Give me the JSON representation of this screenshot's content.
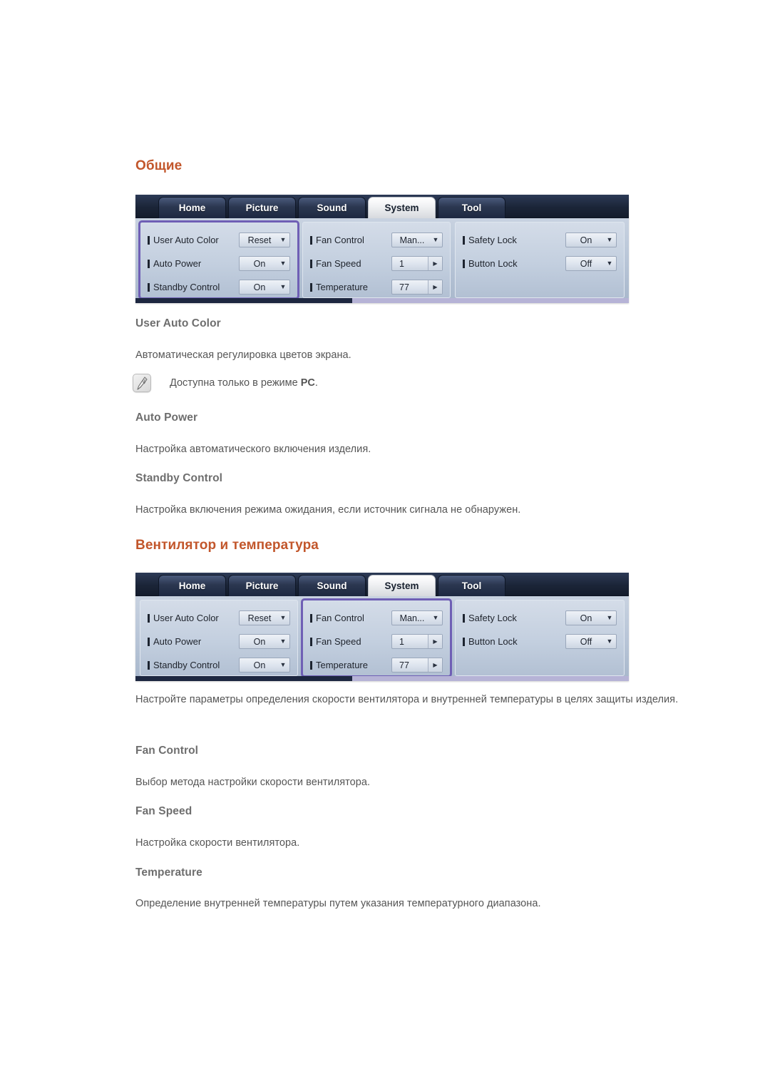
{
  "sections": [
    {
      "heading": "Общие",
      "osd": {
        "tabs": [
          {
            "label": "Home",
            "active": false
          },
          {
            "label": "Picture",
            "active": false
          },
          {
            "label": "Sound",
            "active": false
          },
          {
            "label": "System",
            "active": true
          },
          {
            "label": "Tool",
            "active": false
          }
        ],
        "highlight_column": 0,
        "columns": [
          {
            "rows": [
              {
                "label": "User Auto Color",
                "value": "Reset",
                "control": "dropdown"
              },
              {
                "label": "Auto Power",
                "value": "On",
                "control": "dropdown"
              },
              {
                "label": "Standby Control",
                "value": "On",
                "control": "dropdown"
              }
            ]
          },
          {
            "rows": [
              {
                "label": "Fan Control",
                "value": "Man...",
                "control": "dropdown"
              },
              {
                "label": "Fan Speed",
                "value": "1",
                "control": "spinner"
              },
              {
                "label": "Temperature",
                "value": "77",
                "control": "spinner"
              }
            ]
          },
          {
            "rows": [
              {
                "label": "Safety Lock",
                "value": "On",
                "control": "dropdown"
              },
              {
                "label": "Button Lock",
                "value": "Off",
                "control": "dropdown"
              }
            ]
          }
        ]
      },
      "entries": [
        {
          "title": "User Auto Color",
          "desc": "Автоматическая регулировка цветов экрана.",
          "note": {
            "icon": "note-pencil-icon",
            "text_before": "Доступна только в режиме ",
            "text_bold": "PC",
            "text_after": "."
          }
        },
        {
          "title": "Auto Power",
          "desc": "Настройка автоматического включения изделия."
        },
        {
          "title": "Standby Control",
          "desc": "Настройка включения режима ожидания, если источник сигнала не обнаружен."
        }
      ]
    },
    {
      "heading": "Вентилятор и температура",
      "intro": "Настройте параметры определения скорости вентилятора и внутренней температуры в целях защиты изделия.",
      "entries": [
        {
          "title": "Fan Control",
          "desc": "Выбор метода настройки скорости вентилятора."
        },
        {
          "title": "Fan Speed",
          "desc": "Настройка скорости вентилятора."
        },
        {
          "title": "Temperature",
          "desc": "Определение внутренней температуры путем указания температурного диапазона."
        }
      ]
    }
  ],
  "colors": {
    "heading_orange": "#C2562B",
    "subheading_grey": "#6e6e6e",
    "body_grey": "#555555",
    "osd_highlight_purple": "#6f5fb5",
    "osd_header_navy": "#1b2538"
  }
}
